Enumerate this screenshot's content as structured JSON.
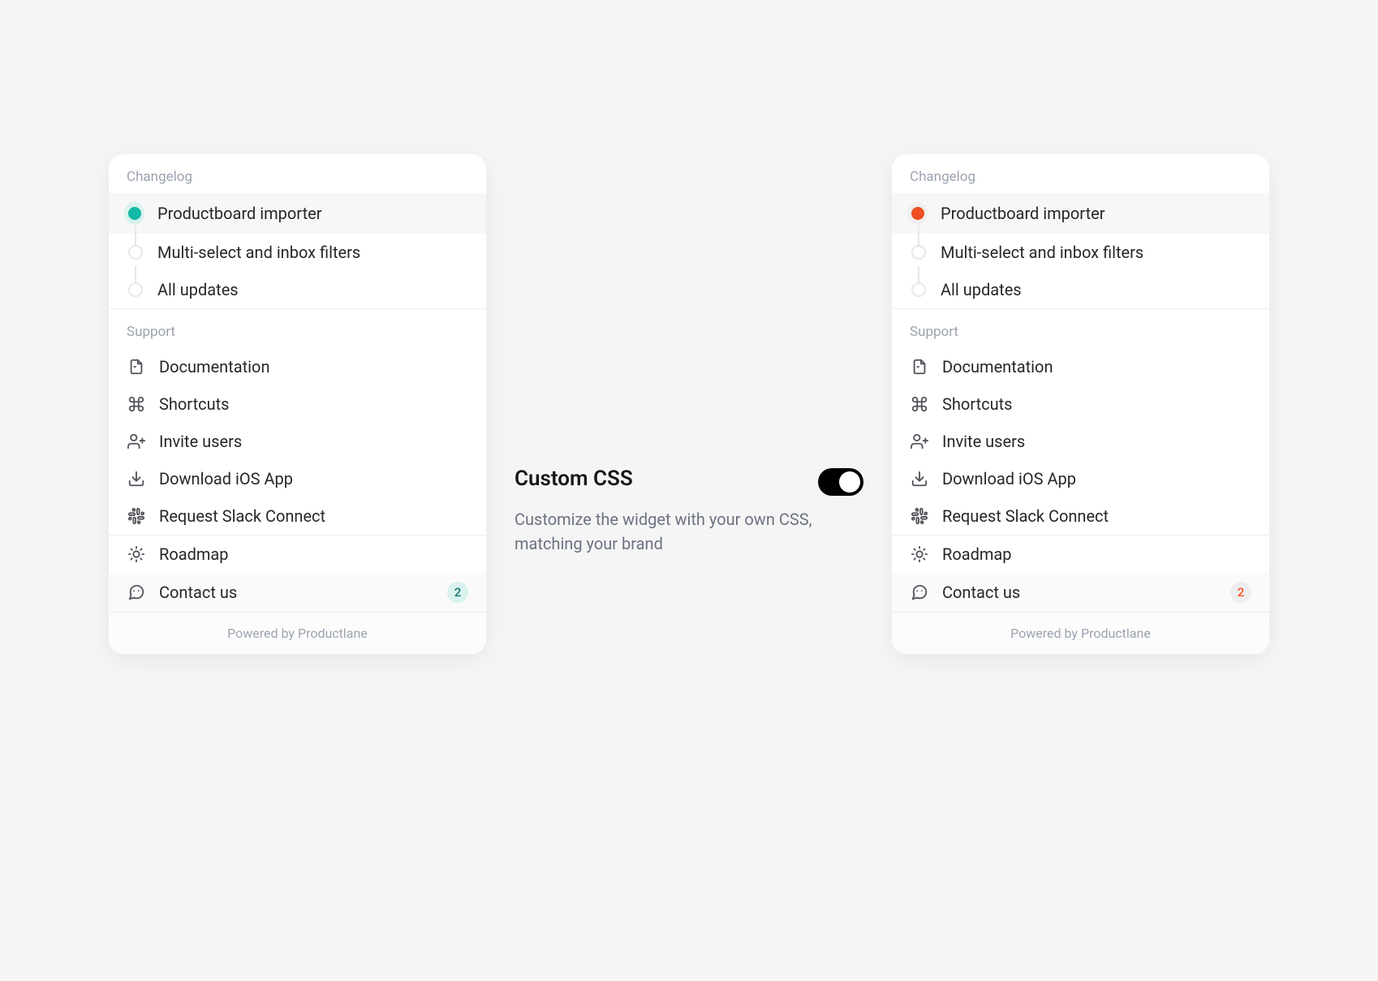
{
  "center": {
    "title": "Custom CSS",
    "description": "Customize the widget with your own CSS, matching your brand",
    "toggle_on": true
  },
  "widget_left": {
    "accent_color": "#14b8a6",
    "accent_halo": "#d9f2ee",
    "badge_bg": "#d9f2ee",
    "badge_fg": "#0f766e",
    "changelog_label": "Changelog",
    "changelog": [
      {
        "label": "Productboard importer",
        "filled": true,
        "highlighted": true
      },
      {
        "label": "Multi-select and inbox filters",
        "filled": false,
        "highlighted": false
      },
      {
        "label": "All updates",
        "filled": false,
        "highlighted": false
      }
    ],
    "support_label": "Support",
    "support": [
      {
        "icon": "file-icon",
        "label": "Documentation"
      },
      {
        "icon": "command-icon",
        "label": "Shortcuts"
      },
      {
        "icon": "user-plus-icon",
        "label": "Invite users"
      },
      {
        "icon": "download-icon",
        "label": "Download iOS App"
      },
      {
        "icon": "slack-icon",
        "label": "Request Slack Connect"
      }
    ],
    "footer_items": [
      {
        "icon": "sun-icon",
        "label": "Roadmap",
        "badge": null
      },
      {
        "icon": "chat-icon",
        "label": "Contact us",
        "badge": "2",
        "is_contact": true
      }
    ],
    "powered_by": "Powered by Productlane"
  },
  "widget_right": {
    "accent_color": "#f04e23",
    "accent_halo": "#f0efef",
    "badge_bg": "#efeeee",
    "badge_fg": "#f04e23",
    "changelog_label": "Changelog",
    "changelog": [
      {
        "label": "Productboard importer",
        "filled": true,
        "highlighted": true
      },
      {
        "label": "Multi-select and inbox filters",
        "filled": false,
        "highlighted": false
      },
      {
        "label": "All updates",
        "filled": false,
        "highlighted": false
      }
    ],
    "support_label": "Support",
    "support": [
      {
        "icon": "file-icon",
        "label": "Documentation"
      },
      {
        "icon": "command-icon",
        "label": "Shortcuts"
      },
      {
        "icon": "user-plus-icon",
        "label": "Invite users"
      },
      {
        "icon": "download-icon",
        "label": "Download iOS App"
      },
      {
        "icon": "slack-icon",
        "label": "Request Slack Connect"
      }
    ],
    "footer_items": [
      {
        "icon": "sun-icon",
        "label": "Roadmap",
        "badge": null
      },
      {
        "icon": "chat-icon",
        "label": "Contact us",
        "badge": "2",
        "is_contact": true
      }
    ],
    "powered_by": "Powered by Productlane"
  }
}
